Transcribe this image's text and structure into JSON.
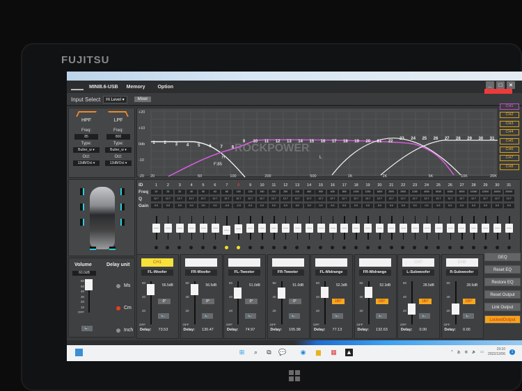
{
  "device": {
    "brand": "FUJITSU"
  },
  "app": {
    "title": "MINI8.6-USB",
    "menu": [
      "Memory",
      "Option"
    ],
    "window_controls": [
      "minimize",
      "maximize",
      "close"
    ],
    "input_select_label": "Input Select",
    "input_select_value": "Hi Level",
    "mixer_label": "Mixer"
  },
  "crossover": {
    "hpf": {
      "label": "HPF",
      "freq_label": "Freq:",
      "freq": "85",
      "type_label": "Type:",
      "type": "Butter_w",
      "oct_label": "Oct:",
      "oct": "12dB/Oct"
    },
    "lpf": {
      "label": "LPF",
      "freq_label": "Freq:",
      "freq": "800",
      "type_label": "Type:",
      "type": "Butter_w",
      "oct_label": "Oct:",
      "oct": "12dB/Oct"
    }
  },
  "graph": {
    "y_labels": [
      "+20",
      "+10",
      "0db",
      "-10",
      "-20"
    ],
    "x_labels": [
      "20",
      "50",
      "100",
      "200",
      "500",
      "1K",
      "2K",
      "5K",
      "10K",
      "20K"
    ],
    "markers": {
      "h": "H",
      "f": "F:85",
      "l": "L"
    },
    "watermark": "ROCKPOWER",
    "band_ids": [
      "1",
      "2",
      "3",
      "4",
      "5",
      "6",
      "7",
      "8",
      "9",
      "10",
      "11",
      "12",
      "13",
      "14",
      "15",
      "16",
      "17",
      "18",
      "19",
      "20",
      "21",
      "22",
      "23",
      "24",
      "25",
      "26",
      "27",
      "28",
      "29",
      "30",
      "31"
    ]
  },
  "channels": [
    "CH1",
    "CH2",
    "CH3",
    "CH4",
    "CH5",
    "CH6",
    "CH7",
    "CH8"
  ],
  "active_channel": "CH1",
  "eq": {
    "row_labels": {
      "id": "ID",
      "freq": "Freq",
      "q": "Q",
      "gain": "Gain"
    },
    "selected_band": "8",
    "freq": [
      "20",
      "25",
      "32",
      "40",
      "50",
      "63",
      "80",
      "100",
      "125",
      "160",
      "200",
      "250",
      "315",
      "400",
      "500",
      "630",
      "800",
      "1000",
      "1250",
      "1600",
      "2000",
      "2500",
      "3150",
      "4000",
      "5040",
      "6350",
      "8000",
      "10080",
      "12500",
      "16000",
      "20000"
    ],
    "q": [
      "12.7",
      "12.7",
      "12.7",
      "12.7",
      "12.7",
      "12.7",
      "12.7",
      "12.7",
      "12.7",
      "12.7",
      "12.7",
      "12.7",
      "12.7",
      "12.7",
      "12.7",
      "12.7",
      "12.7",
      "12.7",
      "12.7",
      "12.7",
      "12.7",
      "12.7",
      "12.7",
      "12.7",
      "12.7",
      "12.7",
      "12.7",
      "12.7",
      "12.7",
      "12.7",
      "12.7"
    ],
    "gain": [
      "0.0",
      "0.0",
      "0.0",
      "0.0",
      "0.0",
      "0.0",
      "-4.5",
      "-2.0",
      "0.0",
      "0.0",
      "0.0",
      "0.0",
      "0.0",
      "0.0",
      "0.0",
      "0.0",
      "0.0",
      "0.0",
      "0.0",
      "0.0",
      "0.0",
      "0.0",
      "0.0",
      "0.0",
      "0.0",
      "0.0",
      "0.0",
      "0.0",
      "0.0",
      "0.0",
      "0.0"
    ],
    "active_dots": [
      "7",
      "8"
    ]
  },
  "volume": {
    "label": "Volume",
    "value": "60.0dB",
    "scale": [
      "60",
      "50",
      "40",
      "30",
      "20",
      "10",
      "OFF"
    ],
    "level_fraction": 1.0
  },
  "delay_unit": {
    "label": "Delay unit",
    "options": [
      "Ms",
      "Cm",
      "Inch"
    ],
    "selected": "Cm"
  },
  "outputs": [
    {
      "ch": "CH1",
      "name": "FL-Woofer",
      "db": "56.5dB",
      "phase": "0°",
      "phase_on": false,
      "delay_label": "Delay:",
      "delay": "73.53",
      "level_fraction": 0.94
    },
    {
      "ch": "",
      "name": "FR-Woofer",
      "db": "56.5dB",
      "phase": "0°",
      "phase_on": false,
      "delay_label": "Delay:",
      "delay": "130.47",
      "level_fraction": 0.94
    },
    {
      "ch": "",
      "name": "FL-Tweeter",
      "db": "51.0dB",
      "phase": "0°",
      "phase_on": false,
      "delay_label": "Delay:",
      "delay": "74.97",
      "level_fraction": 0.85
    },
    {
      "ch": "",
      "name": "FR-Tweeter",
      "db": "51.0dB",
      "phase": "0°",
      "phase_on": false,
      "delay_label": "Delay:",
      "delay": "105.98",
      "level_fraction": 0.85
    },
    {
      "ch": "",
      "name": "FL-Midrange",
      "db": "52.3dB",
      "phase": "180°",
      "phase_on": true,
      "delay_label": "Delay:",
      "delay": "77.13",
      "level_fraction": 0.87
    },
    {
      "ch": "",
      "name": "FR-Midrange",
      "db": "52.3dB",
      "phase": "180°",
      "phase_on": true,
      "delay_label": "Delay:",
      "delay": "132.63",
      "level_fraction": 0.87
    },
    {
      "ch": "CH7",
      "name": "L-Subwoofer",
      "db": "28.5dB",
      "phase": "180°",
      "phase_on": true,
      "delay_label": "Delay:",
      "delay": "0.00",
      "level_fraction": 0.47
    },
    {
      "ch": "CH8",
      "name": "R-Subwoofer",
      "db": "28.5dB",
      "phase": "180°",
      "phase_on": true,
      "delay_label": "Delay:",
      "delay": "0.00",
      "level_fraction": 0.47
    }
  ],
  "output_scale": [
    "60",
    "40",
    "20",
    "OFF"
  ],
  "side_buttons": [
    "GEQ",
    "Reset EQ",
    "Restore EQ",
    "Reset Output",
    "Link Output",
    "LockedOutput"
  ],
  "taskbar": {
    "time": "19:10",
    "date": "2022/12/06",
    "ime": "あ",
    "notifications": "1"
  }
}
